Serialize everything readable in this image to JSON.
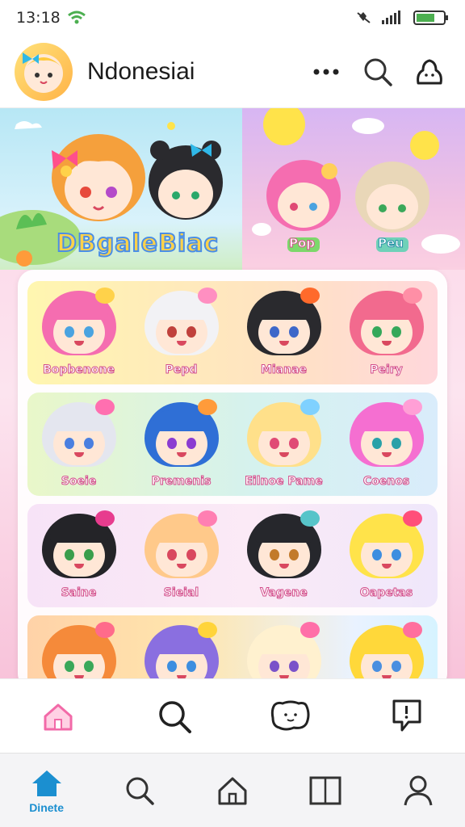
{
  "status": {
    "time": "13:18",
    "battery_icon": "battery-icon",
    "wifi_icon": "wifi-icon"
  },
  "header": {
    "title": "Ndonesiai",
    "more_icon": "more-dots-icon",
    "search_icon": "search-icon",
    "profile_icon": "blob-icon"
  },
  "banner": {
    "title": "DBgaleBiac",
    "tag_left": "Pop",
    "tag_right": "Peu"
  },
  "grid": {
    "rows": [
      {
        "bg": "linear-gradient(90deg,#fff6b0,#ffe3c2 60%,#ffd7dc)",
        "items": [
          {
            "label": "Bopbenone",
            "hair": "#f56db0",
            "eye": "#4aa3e0",
            "acc": "#ffd24a"
          },
          {
            "label": "Pepd",
            "hair": "#f2f2f5",
            "eye": "#c0413c",
            "acc": "#ff8fc1"
          },
          {
            "label": "Mianae",
            "hair": "#2a2a2e",
            "eye": "#3d67c9",
            "acc": "#ff6a2b"
          },
          {
            "label": "Peiry",
            "hair": "#f26a8e",
            "eye": "#35a85a",
            "acc": "#ff8fa6"
          }
        ]
      },
      {
        "bg": "linear-gradient(90deg,#e9f7c9,#d5f2ee 55%,#d9ecfb)",
        "items": [
          {
            "label": "Soeie",
            "hair": "#e4e6ef",
            "eye": "#4a7fe0",
            "acc": "#ff6fb0"
          },
          {
            "label": "Premenis",
            "hair": "#2f6fd6",
            "eye": "#8b3cd1",
            "acc": "#ff9b3a"
          },
          {
            "label": "Eilnoe Pame",
            "hair": "#ffe08a",
            "eye": "#e04a75",
            "acc": "#7fd1ff"
          },
          {
            "label": "Coenos",
            "hair": "#f56fd1",
            "eye": "#2aa1a8",
            "acc": "#ff9fd6"
          }
        ]
      },
      {
        "bg": "linear-gradient(90deg,#f7e3f7,#fbeaf6 55%,#efe7fb)",
        "items": [
          {
            "label": "Saine",
            "hair": "#242428",
            "eye": "#3a9e4c",
            "acc": "#e73c8e"
          },
          {
            "label": "Sieial",
            "hair": "#ffc98a",
            "eye": "#d9485f",
            "acc": "#ff7fb2"
          },
          {
            "label": "Vagene",
            "hair": "#26272c",
            "eye": "#c27a2a",
            "acc": "#57c4c9"
          },
          {
            "label": "Oapetas",
            "hair": "#ffe34a",
            "eye": "#3d8ee0",
            "acc": "#ff4f7a"
          }
        ]
      },
      {
        "bg": "linear-gradient(90deg,#ffd2a8,#ffe6ad 40%,#e9f2ff 80%,#d6f3ff)",
        "items": [
          {
            "label": "",
            "hair": "#f58a3a",
            "eye": "#3aa85a",
            "acc": "#ff6b8b"
          },
          {
            "label": "",
            "hair": "#8a6fe0",
            "eye": "#3d8ee0",
            "acc": "#ffd43a"
          },
          {
            "label": "",
            "hair": "#fff1cf",
            "eye": "#7a52c9",
            "acc": "#ff6fa8"
          },
          {
            "label": "",
            "hair": "#ffd83a",
            "eye": "#4a8fe0",
            "acc": "#ff6f9e"
          }
        ]
      }
    ]
  },
  "action_bar": {
    "icons": [
      "home-outline-icon",
      "search-icon",
      "chat-face-icon",
      "comment-icon"
    ]
  },
  "tab_bar": {
    "active_label": "Dinete",
    "tabs": [
      "home-icon",
      "search-icon",
      "house-icon",
      "book-icon",
      "profile-icon"
    ]
  },
  "colors": {
    "accent": "#1b8fd0",
    "pink": "#f26aa8"
  }
}
